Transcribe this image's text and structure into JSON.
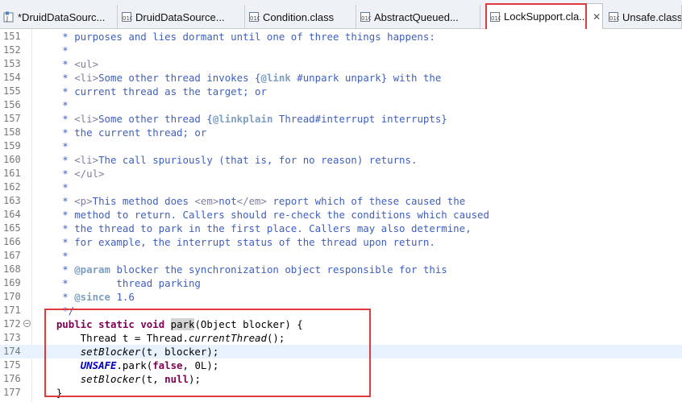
{
  "tabs": [
    {
      "label": "*DruidDataSourc...",
      "icon": "java-source-icon",
      "active": false
    },
    {
      "label": "DruidDataSource...",
      "icon": "class-file-icon",
      "active": false
    },
    {
      "label": "Condition.class",
      "icon": "class-file-icon",
      "active": false
    },
    {
      "label": "AbstractQueued...",
      "icon": "class-file-icon",
      "active": false
    },
    {
      "label": "LockSupport.cla...",
      "icon": "class-file-icon",
      "active": true
    },
    {
      "label": "Unsafe.class",
      "icon": "class-file-icon",
      "active": false
    }
  ],
  "close_glyph": "✕",
  "editor": {
    "current_line": "174",
    "lines": [
      {
        "num": "151",
        "segs": [
          {
            "t": "     * purposes and lies dormant until one of three things happens:",
            "c": "cmt"
          }
        ]
      },
      {
        "num": "152",
        "segs": [
          {
            "t": "     *",
            "c": "cmt"
          }
        ]
      },
      {
        "num": "153",
        "segs": [
          {
            "t": "     * ",
            "c": "cmt"
          },
          {
            "t": "<ul>",
            "c": "tag"
          }
        ]
      },
      {
        "num": "154",
        "segs": [
          {
            "t": "     * ",
            "c": "cmt"
          },
          {
            "t": "<li>",
            "c": "tag"
          },
          {
            "t": "Some other thread invokes {",
            "c": "cmt"
          },
          {
            "t": "@link",
            "c": "jdk"
          },
          {
            "t": " #unpark unpark} with the",
            "c": "cmt"
          }
        ]
      },
      {
        "num": "155",
        "segs": [
          {
            "t": "     * current thread as the target; or",
            "c": "cmt"
          }
        ]
      },
      {
        "num": "156",
        "segs": [
          {
            "t": "     *",
            "c": "cmt"
          }
        ]
      },
      {
        "num": "157",
        "segs": [
          {
            "t": "     * ",
            "c": "cmt"
          },
          {
            "t": "<li>",
            "c": "tag"
          },
          {
            "t": "Some other thread {",
            "c": "cmt"
          },
          {
            "t": "@linkplain",
            "c": "jdk"
          },
          {
            "t": " Thread#interrupt interrupts}",
            "c": "cmt"
          }
        ]
      },
      {
        "num": "158",
        "segs": [
          {
            "t": "     * the current thread; or",
            "c": "cmt"
          }
        ]
      },
      {
        "num": "159",
        "segs": [
          {
            "t": "     *",
            "c": "cmt"
          }
        ]
      },
      {
        "num": "160",
        "segs": [
          {
            "t": "     * ",
            "c": "cmt"
          },
          {
            "t": "<li>",
            "c": "tag"
          },
          {
            "t": "The call spuriously (that is, for no reason) returns.",
            "c": "cmt"
          }
        ]
      },
      {
        "num": "161",
        "segs": [
          {
            "t": "     * ",
            "c": "cmt"
          },
          {
            "t": "</ul>",
            "c": "tag"
          }
        ]
      },
      {
        "num": "162",
        "segs": [
          {
            "t": "     *",
            "c": "cmt"
          }
        ]
      },
      {
        "num": "163",
        "segs": [
          {
            "t": "     * ",
            "c": "cmt"
          },
          {
            "t": "<p>",
            "c": "tag"
          },
          {
            "t": "This method does ",
            "c": "cmt"
          },
          {
            "t": "<em>",
            "c": "tag"
          },
          {
            "t": "not",
            "c": "cmt"
          },
          {
            "t": "</em>",
            "c": "tag"
          },
          {
            "t": " report which of these caused the",
            "c": "cmt"
          }
        ]
      },
      {
        "num": "164",
        "segs": [
          {
            "t": "     * method to return. Callers should re-check the conditions which caused",
            "c": "cmt"
          }
        ]
      },
      {
        "num": "165",
        "segs": [
          {
            "t": "     * the thread to park in the first place. Callers may also determine,",
            "c": "cmt"
          }
        ]
      },
      {
        "num": "166",
        "segs": [
          {
            "t": "     * for example, the interrupt status of the thread upon return.",
            "c": "cmt"
          }
        ]
      },
      {
        "num": "167",
        "segs": [
          {
            "t": "     *",
            "c": "cmt"
          }
        ]
      },
      {
        "num": "168",
        "segs": [
          {
            "t": "     * ",
            "c": "cmt"
          },
          {
            "t": "@param",
            "c": "jdk"
          },
          {
            "t": " blocker the synchronization object responsible for this",
            "c": "cmt"
          }
        ]
      },
      {
        "num": "169",
        "segs": [
          {
            "t": "     *        thread parking",
            "c": "cmt"
          }
        ]
      },
      {
        "num": "170",
        "segs": [
          {
            "t": "     * ",
            "c": "cmt"
          },
          {
            "t": "@since",
            "c": "jdk"
          },
          {
            "t": " 1.6",
            "c": "cmt"
          }
        ]
      },
      {
        "num": "171",
        "segs": [
          {
            "t": "     */",
            "c": "cmt"
          }
        ]
      },
      {
        "num": "172",
        "fold": true,
        "segs": [
          {
            "t": "    ",
            "c": ""
          },
          {
            "t": "public",
            "c": "kw"
          },
          {
            "t": " ",
            "c": ""
          },
          {
            "t": "static",
            "c": "kw"
          },
          {
            "t": " ",
            "c": ""
          },
          {
            "t": "void",
            "c": "kw"
          },
          {
            "t": " ",
            "c": ""
          },
          {
            "t": "park",
            "c": "mark"
          },
          {
            "t": "(Object blocker) {",
            "c": ""
          }
        ]
      },
      {
        "num": "173",
        "segs": [
          {
            "t": "        Thread t = Thread.",
            "c": ""
          },
          {
            "t": "currentThread",
            "c": "it"
          },
          {
            "t": "();",
            "c": ""
          }
        ]
      },
      {
        "num": "174",
        "segs": [
          {
            "t": "        ",
            "c": ""
          },
          {
            "t": "setBlocker",
            "c": "it"
          },
          {
            "t": "(t, blocker);",
            "c": ""
          }
        ]
      },
      {
        "num": "175",
        "segs": [
          {
            "t": "        ",
            "c": ""
          },
          {
            "t": "UNSAFE",
            "c": "fld"
          },
          {
            "t": ".park(",
            "c": ""
          },
          {
            "t": "false",
            "c": "kw"
          },
          {
            "t": ", 0L);",
            "c": ""
          }
        ]
      },
      {
        "num": "176",
        "segs": [
          {
            "t": "        ",
            "c": ""
          },
          {
            "t": "setBlocker",
            "c": "it"
          },
          {
            "t": "(t, ",
            "c": ""
          },
          {
            "t": "null",
            "c": "kw"
          },
          {
            "t": ");",
            "c": ""
          }
        ]
      },
      {
        "num": "177",
        "segs": [
          {
            "t": "    }",
            "c": ""
          }
        ]
      }
    ]
  }
}
